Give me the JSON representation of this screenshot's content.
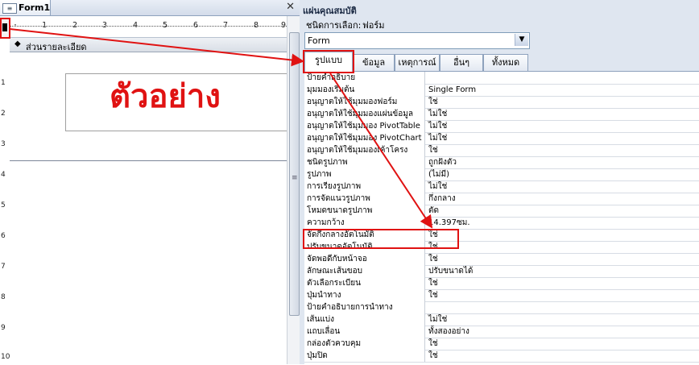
{
  "designer": {
    "tab_label": "Form1",
    "form_icon": "form-icon",
    "close_glyph": "✕",
    "ruler_ticks": [
      "1",
      "2",
      "3",
      "4",
      "5",
      "6",
      "7",
      "8",
      "9"
    ],
    "vertical_ticks": [
      "1",
      "2",
      "3",
      "4",
      "5",
      "6",
      "7",
      "8",
      "9",
      "10"
    ],
    "section_label": "ส่วนรายละเอียด",
    "title_text": "ตัวอย่าง"
  },
  "property_sheet": {
    "title": "แผ่นคุณสมบัติ",
    "selection_type_label": "ชนิดการเลือก:",
    "selection_type_value": "ฟอร์ม",
    "object_selector_value": "Form",
    "tabs": [
      {
        "label": "รูปแบบ",
        "active": true
      },
      {
        "label": "ข้อมูล",
        "active": false
      },
      {
        "label": "เหตุการณ์",
        "active": false
      },
      {
        "label": "อื่นๆ",
        "active": false
      },
      {
        "label": "ทั้งหมด",
        "active": false
      }
    ],
    "rows": [
      {
        "name": "ป้ายคำอธิบาย",
        "value": ""
      },
      {
        "name": "มุมมองเริ่มต้น",
        "value": "Single Form"
      },
      {
        "name": "อนุญาตให้ใช้มุมมองฟอร์ม",
        "value": "ใช่"
      },
      {
        "name": "อนุญาตให้ใช้มุมมองแผ่นข้อมูล",
        "value": "ไม่ใช่"
      },
      {
        "name": "อนุญาตให้ใช้มุมมอง PivotTable",
        "value": "ไม่ใช่"
      },
      {
        "name": "อนุญาตให้ใช้มุมมอง PivotChart",
        "value": "ไม่ใช่"
      },
      {
        "name": "อนุญาตให้ใช้มุมมองเค้าโครง",
        "value": "ใช่"
      },
      {
        "name": "ชนิดรูปภาพ",
        "value": "ถูกฝังตัว"
      },
      {
        "name": "รูปภาพ",
        "value": "(ไม่มี)"
      },
      {
        "name": "การเรียงรูปภาพ",
        "value": "ไม่ใช่"
      },
      {
        "name": "การจัดแนวรูปภาพ",
        "value": "กึ่งกลาง"
      },
      {
        "name": "โหมดขนาดรูปภาพ",
        "value": "ตัด"
      },
      {
        "name": "ความกว้าง",
        "value": "14.397ซม."
      },
      {
        "name": "จัดกึ่งกลางอัตโนมัติ",
        "value": "ใช่"
      },
      {
        "name": "ปรับขนาดอัตโนมัติ",
        "value": "ใช่"
      },
      {
        "name": "จัดพอดีกับหน้าจอ",
        "value": "ใช่"
      },
      {
        "name": "ลักษณะเส้นขอบ",
        "value": "ปรับขนาดได้"
      },
      {
        "name": "ตัวเลือกระเบียน",
        "value": "ใช่"
      },
      {
        "name": "ปุ่มนำทาง",
        "value": "ใช่"
      },
      {
        "name": "ป้ายคำอธิบายการนำทาง",
        "value": ""
      },
      {
        "name": "เส้นแบ่ง",
        "value": "ไม่ใช่"
      },
      {
        "name": "แถบเลื่อน",
        "value": "ทั้งสองอย่าง"
      },
      {
        "name": "กล่องตัวควบคุม",
        "value": "ใช่"
      },
      {
        "name": "ปุ่มปิด",
        "value": "ใช่"
      }
    ]
  },
  "colors": {
    "annotation_red": "#e01212",
    "title_red": "#e01212"
  }
}
